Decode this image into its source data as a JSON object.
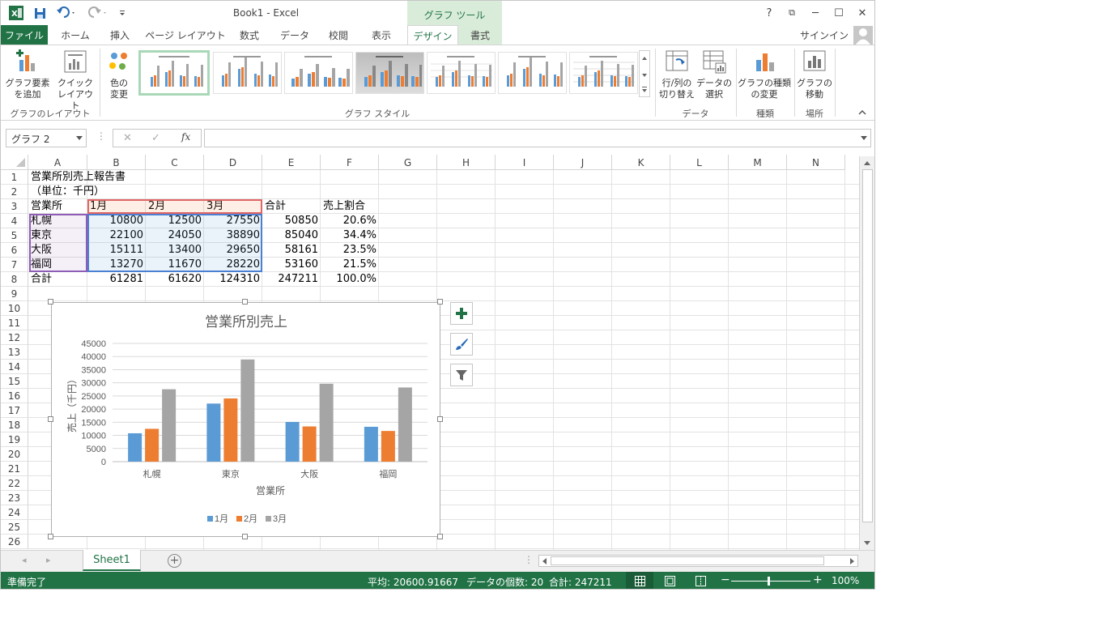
{
  "titlebar": {
    "title": "Book1 - Excel",
    "context_tool": "グラフ ツール",
    "help": "?",
    "restore": "⧉",
    "minimize": "─",
    "maximize": "☐",
    "close": "✕"
  },
  "tabs": {
    "file": "ファイル",
    "home": "ホーム",
    "insert": "挿入",
    "page_layout": "ページ レイアウト",
    "formulas": "数式",
    "data": "データ",
    "review": "校閲",
    "view": "表示",
    "design": "デザイン",
    "format": "書式",
    "signin": "サインイン"
  },
  "ribbon": {
    "add_element": [
      "グラフ要素",
      "を追加"
    ],
    "quick_layout": [
      "クイック",
      "レイアウト"
    ],
    "change_colors": [
      "色の",
      "変更"
    ],
    "switch_row_col": [
      "行/列の",
      "切り替え"
    ],
    "select_data": [
      "データの",
      "選択"
    ],
    "change_type": [
      "グラフの種類",
      "の変更"
    ],
    "move_chart": [
      "グラフの",
      "移動"
    ],
    "groups": {
      "layout": "グラフのレイアウト",
      "styles": "グラフ スタイル",
      "data": "データ",
      "type": "種類",
      "location": "場所"
    }
  },
  "formula_bar": {
    "name_box": "グラフ 2",
    "fx": "fx",
    "value": ""
  },
  "columns": [
    "A",
    "B",
    "C",
    "D",
    "E",
    "F",
    "G",
    "H",
    "I",
    "J",
    "K",
    "L",
    "M",
    "N"
  ],
  "rows": [
    "1",
    "2",
    "3",
    "4",
    "5",
    "6",
    "7",
    "8",
    "9",
    "10",
    "11",
    "12",
    "13",
    "14",
    "15",
    "16",
    "17",
    "18",
    "19",
    "20",
    "21",
    "22",
    "23",
    "24",
    "25",
    "26"
  ],
  "sheet": {
    "title": "営業所別売上報告書",
    "unit": "（単位：千円）",
    "header": [
      "営業所",
      "1月",
      "2月",
      "3月",
      "合計",
      "売上割合"
    ],
    "data_rows": [
      [
        "札幌",
        "10800",
        "12500",
        "27550",
        "50850",
        "20.6%"
      ],
      [
        "東京",
        "22100",
        "24050",
        "38890",
        "85040",
        "34.4%"
      ],
      [
        "大阪",
        "15111",
        "13400",
        "29650",
        "58161",
        "23.5%"
      ],
      [
        "福岡",
        "13270",
        "11670",
        "28220",
        "53160",
        "21.5%"
      ],
      [
        "合計",
        "61281",
        "61620",
        "124310",
        "247211",
        "100.0%"
      ]
    ]
  },
  "chart_data": {
    "type": "bar",
    "title": "営業所別売上",
    "xlabel": "営業所",
    "ylabel": "売上（千円）",
    "categories": [
      "札幌",
      "東京",
      "大阪",
      "福岡"
    ],
    "series": [
      {
        "name": "1月",
        "values": [
          10800,
          22100,
          15111,
          13270
        ],
        "color": "#5b9bd5"
      },
      {
        "name": "2月",
        "values": [
          12500,
          24050,
          13400,
          11670
        ],
        "color": "#ed7d31"
      },
      {
        "name": "3月",
        "values": [
          27550,
          38890,
          29650,
          28220
        ],
        "color": "#a5a5a5"
      }
    ],
    "ylim": [
      0,
      45000
    ],
    "yticks": [
      "45000",
      "40000",
      "35000",
      "30000",
      "25000",
      "20000",
      "15000",
      "10000",
      "5000",
      "0"
    ],
    "grid": true,
    "legend": "bottom"
  },
  "sheet_tabs": {
    "active": "Sheet1"
  },
  "status": {
    "ready": "準備完了",
    "average": "平均: 20600.91667",
    "count": "データの個数: 20",
    "sum": "合計: 247211",
    "zoom": "100%"
  },
  "colors": {
    "excel_green": "#217346",
    "context_bg": "#d9ecd9"
  }
}
